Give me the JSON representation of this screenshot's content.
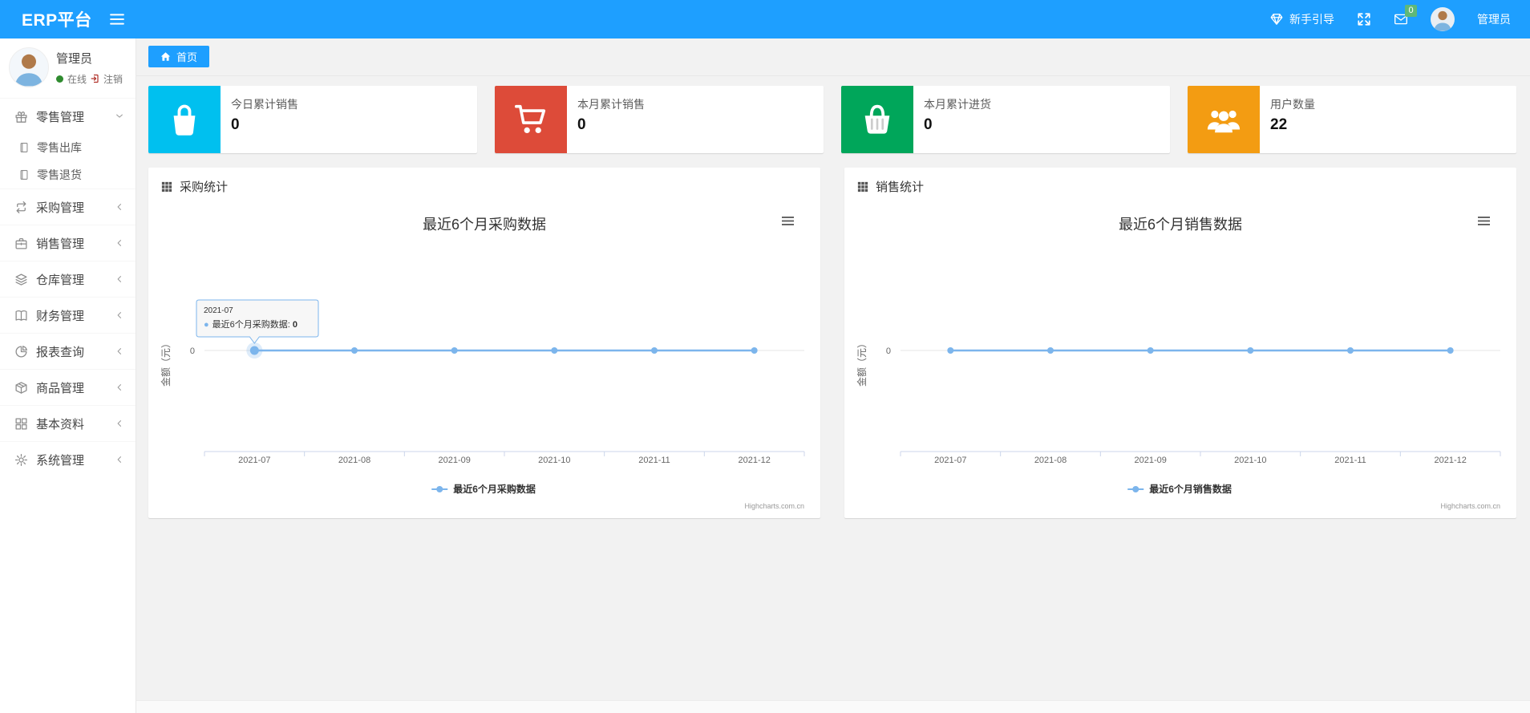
{
  "colors": {
    "navbar_blue": "#1e9fff",
    "badge_green": "#5fb878",
    "online_green": "#2f8b2f",
    "logout_red": "#b03028",
    "card_cyan": "#00c0ef",
    "card_red": "#dd4b39",
    "card_green": "#00a65a",
    "card_orange": "#f39c12",
    "series_blue": "#7cb5ec",
    "axis_line": "#ccd6eb",
    "grid_line": "#e6e6e6",
    "chart_text": "#666666",
    "chart_title": "#333333",
    "credits_gray": "#999999"
  },
  "navbar": {
    "brand": "ERP平台",
    "guide_label": "新手引导",
    "messages_badge": "0",
    "username": "管理员"
  },
  "sidebar": {
    "user": {
      "name": "管理员",
      "status": "在线",
      "logout": "注销"
    },
    "menu": [
      {
        "label": "零售管理",
        "icon": "gift-icon",
        "expanded": true,
        "children": [
          {
            "label": "零售出库",
            "icon": "file-icon"
          },
          {
            "label": "零售退货",
            "icon": "file-icon"
          }
        ]
      },
      {
        "label": "采购管理",
        "icon": "repeat-icon"
      },
      {
        "label": "销售管理",
        "icon": "briefcase-icon"
      },
      {
        "label": "仓库管理",
        "icon": "layers-icon"
      },
      {
        "label": "财务管理",
        "icon": "book-icon"
      },
      {
        "label": "报表查询",
        "icon": "pie-chart-icon"
      },
      {
        "label": "商品管理",
        "icon": "box-icon"
      },
      {
        "label": "基本资料",
        "icon": "grid4-icon"
      },
      {
        "label": "系统管理",
        "icon": "gear-icon"
      }
    ]
  },
  "breadcrumb": {
    "active_tab": "首页"
  },
  "stat_cards": [
    {
      "label": "今日累计销售",
      "value": "0",
      "color": "#00c0ef",
      "icon": "bag-icon"
    },
    {
      "label": "本月累计销售",
      "value": "0",
      "color": "#dd4b39",
      "icon": "cart-icon"
    },
    {
      "label": "本月累计进货",
      "value": "0",
      "color": "#00a65a",
      "icon": "basket-icon"
    },
    {
      "label": "用户数量",
      "value": "22",
      "color": "#f39c12",
      "icon": "users-icon"
    }
  ],
  "chart_data": [
    {
      "type": "line",
      "panel_title": "采购统计",
      "title": "最近6个月采购数据",
      "categories": [
        "2021-07",
        "2021-08",
        "2021-09",
        "2021-10",
        "2021-11",
        "2021-12"
      ],
      "series": [
        {
          "name": "最近6个月采购数据",
          "values": [
            0,
            0,
            0,
            0,
            0,
            0
          ]
        }
      ],
      "xlabel": "",
      "ylabel": "金额（元）",
      "yticks": [
        "0"
      ],
      "ylim": [
        -1,
        1
      ],
      "grid": "zero-line-only",
      "legend_position": "bottom",
      "credits": "Highcharts.com.cn",
      "tooltip": {
        "visible": true,
        "point_index": 0,
        "header": "2021-07",
        "series_name": "最近6个月采购数据",
        "value": "0"
      }
    },
    {
      "type": "line",
      "panel_title": "销售统计",
      "title": "最近6个月销售数据",
      "categories": [
        "2021-07",
        "2021-08",
        "2021-09",
        "2021-10",
        "2021-11",
        "2021-12"
      ],
      "series": [
        {
          "name": "最近6个月销售数据",
          "values": [
            0,
            0,
            0,
            0,
            0,
            0
          ]
        }
      ],
      "xlabel": "",
      "ylabel": "金额（元）",
      "yticks": [
        "0"
      ],
      "ylim": [
        -1,
        1
      ],
      "grid": "zero-line-only",
      "legend_position": "bottom",
      "credits": "Highcharts.com.cn",
      "tooltip": {
        "visible": false
      }
    }
  ]
}
